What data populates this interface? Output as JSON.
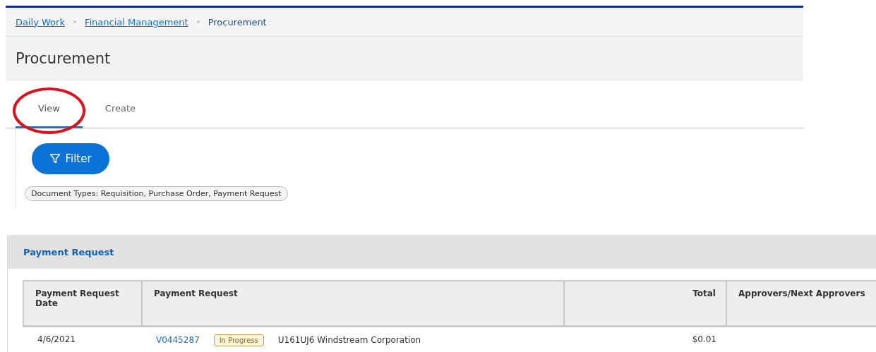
{
  "breadcrumbs": [
    {
      "label": "Daily Work",
      "link": true
    },
    {
      "label": "Financial Management",
      "link": true
    },
    {
      "label": "Procurement",
      "link": false
    }
  ],
  "page_title": "Procurement",
  "tabs": [
    {
      "label": "View",
      "selected": true,
      "circled": true
    },
    {
      "label": "Create",
      "selected": false,
      "circled": false
    }
  ],
  "filter_button": {
    "label": "Filter"
  },
  "filter_chips": [
    "Document Types: Requisition, Purchase Order, Payment Request"
  ],
  "panel": {
    "title": "Payment Request",
    "table": {
      "columns": [
        {
          "label": "Payment Request Date",
          "numeric": false
        },
        {
          "label": "Payment Request",
          "numeric": false
        },
        {
          "label": "Total",
          "numeric": true
        },
        {
          "label": "Approvers/Next Approvers",
          "numeric": false
        }
      ],
      "rows": [
        {
          "date": "4/6/2021",
          "number": "V0445287",
          "status": {
            "label": "In Progress",
            "kind": "in-progress"
          },
          "vendor": "U161UJ6 Windstream Corporation",
          "total": "$0.01"
        }
      ]
    }
  }
}
